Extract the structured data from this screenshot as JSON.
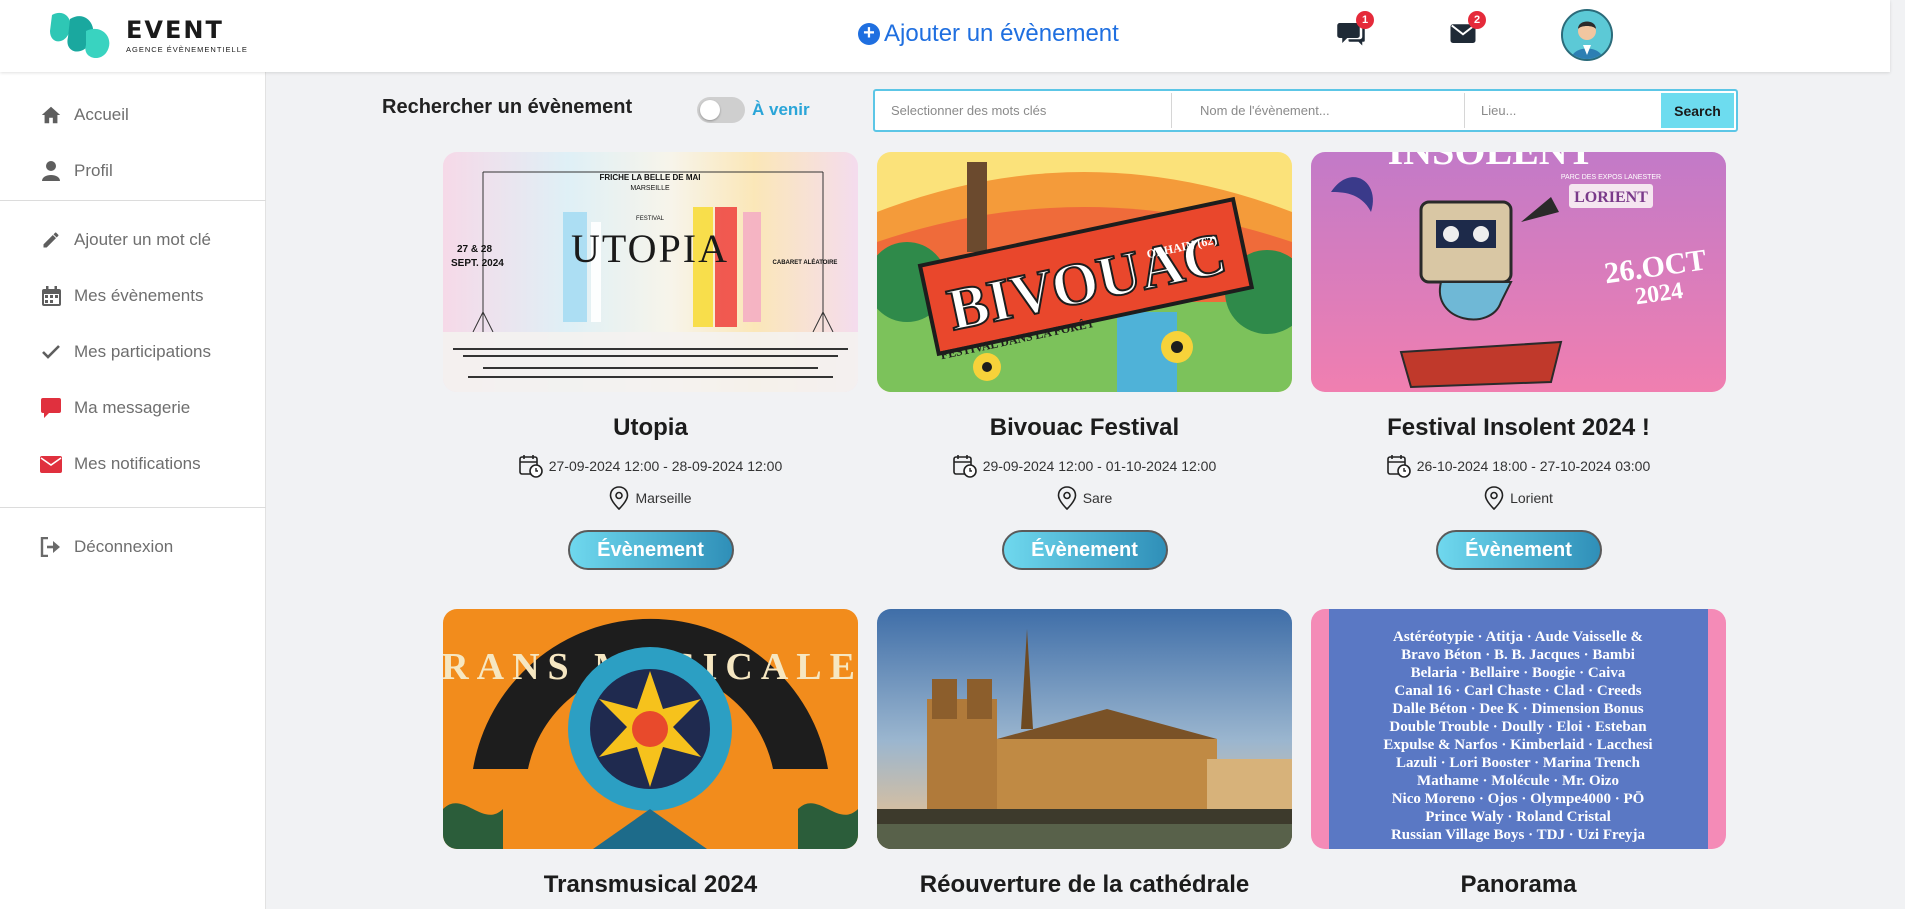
{
  "brand": {
    "name": "EVENT",
    "tagline": "AGENCE ÉVÈNEMENTIELLE"
  },
  "header": {
    "add_event_label": "Ajouter un évènement",
    "messages_badge": "1",
    "mail_badge": "2"
  },
  "sidebar": {
    "items": [
      {
        "label": "Accueil",
        "icon": "home-icon"
      },
      {
        "label": "Profil",
        "icon": "user-icon"
      },
      {
        "label": "Ajouter un mot clé",
        "icon": "pencil-icon"
      },
      {
        "label": "Mes évènements",
        "icon": "calendar-icon"
      },
      {
        "label": "Mes participations",
        "icon": "check-icon"
      },
      {
        "label": "Ma messagerie",
        "icon": "chat-icon"
      },
      {
        "label": "Mes notifications",
        "icon": "mail-icon"
      },
      {
        "label": "Déconnexion",
        "icon": "logout-icon"
      }
    ]
  },
  "search": {
    "title": "Rechercher un évènement",
    "toggle_label": "À venir",
    "keywords_placeholder": "Selectionner des mots clés",
    "name_placeholder": "Nom de l'évènement...",
    "place_placeholder": "Lieu...",
    "button_label": "Search"
  },
  "events": [
    {
      "title": "Utopia",
      "dates": "27-09-2024 12:00 - 28-09-2024 12:00",
      "location": "Marseille",
      "button": "Évènement",
      "poster": {
        "header": "FRICHE LA BELLE DE MAI",
        "city": "MARSEILLE",
        "label": "FESTIVAL",
        "name": "UTOPIA",
        "date_line1": "27 & 28",
        "date_line2": "SEPT. 2024",
        "brand": "CABARET ALÉATOIRE"
      }
    },
    {
      "title": "Bivouac Festival",
      "dates": "29-09-2024 12:00 - 01-10-2024 12:00",
      "location": "Sare",
      "button": "Évènement",
      "poster": {
        "name": "BIVOUAC",
        "tagline": "FESTIVAL DANS LA FORÊT",
        "place": "OLHAIN (62)"
      }
    },
    {
      "title": "Festival Insolent 2024 !",
      "dates": "26-10-2024 18:00 - 27-10-2024 03:00",
      "location": "Lorient",
      "button": "Évènement",
      "poster": {
        "name": "INSOLENT",
        "venue": "PARC DES EXPOS LANESTER",
        "city": "LORIENT",
        "date": "26.OCT",
        "year": "2024"
      }
    },
    {
      "title": "Transmusical 2024",
      "poster": {
        "name": "TRANS MUSICALES"
      }
    },
    {
      "title": "Réouverture de la cathédrale",
      "poster": {}
    },
    {
      "title": "Panorama",
      "poster": {
        "lines": [
          "Astéréotypie · Atitja · Aude Vaisselle &",
          "Bravo Béton · B. B. Jacques · Bambi",
          "Belaria · Bellaire · Boogie · Caiva",
          "Canal 16 · Carl Chaste · Clad · Creeds",
          "Dalle Béton · Dee K · Dimension Bonus",
          "Double Trouble · Doully · Eloi · Esteban",
          "Expulse & Narfos · Kimberlaid · Lacchesi",
          "Lazuli · Lori Booster · Marina Trench",
          "Mathame · Molécule · Mr. Oizo",
          "Nico Moreno · Ojos · Olympe4000 · PŌ",
          "Prince Waly · Roland Cristal",
          "Russian Village Boys · TDJ · Uzi Freyja"
        ]
      }
    }
  ],
  "colors": {
    "accent": "#1f6fe0",
    "search_border": "#5cc6e6",
    "badge": "#e52a3a",
    "toggle_label": "#2aa5d8"
  }
}
